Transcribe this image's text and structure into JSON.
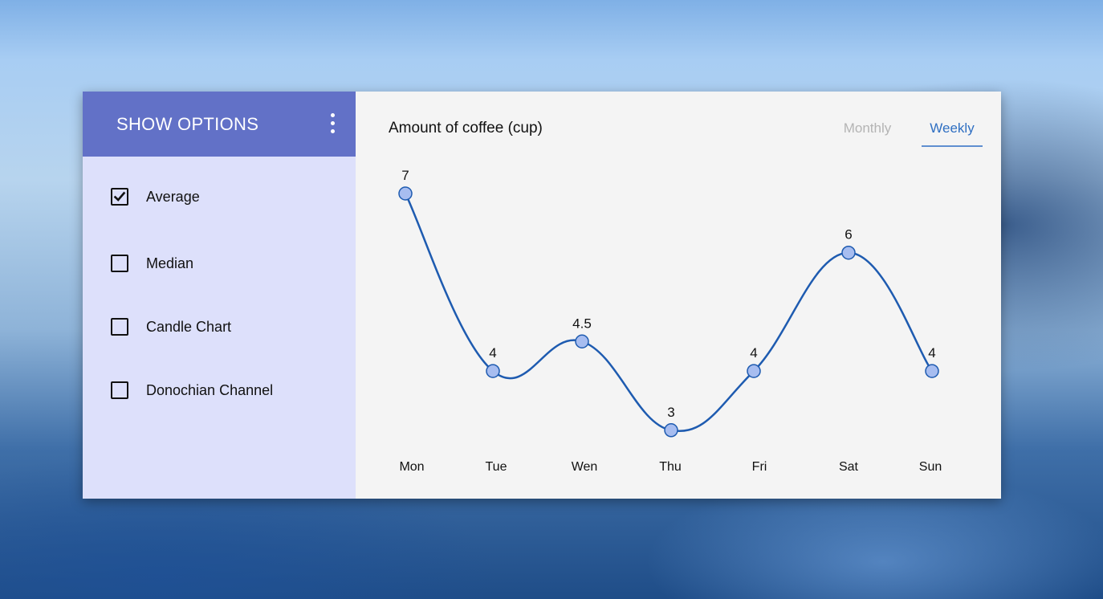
{
  "sidebar": {
    "title": "SHOW OPTIONS",
    "menu_icon": "kebab-menu-icon",
    "options": [
      {
        "label": "Average",
        "checked": true
      },
      {
        "label": "Median",
        "checked": false
      },
      {
        "label": "Candle Chart",
        "checked": false
      },
      {
        "label": "Donochian Channel",
        "checked": false
      }
    ]
  },
  "main": {
    "tabs": [
      {
        "label": "Monthly",
        "active": false
      },
      {
        "label": "Weekly",
        "active": true
      }
    ]
  },
  "colors": {
    "header": "#6271c7",
    "sidebar_bg": "#dde0fb",
    "line": "#1e5bb0",
    "point_fill": "#a7bdf0",
    "active_tab": "#2f6fc2"
  },
  "chart_data": {
    "type": "line",
    "title": "Amount of coffee (cup)",
    "categories": [
      "Mon",
      "Tue",
      "Wen",
      "Thu",
      "Fri",
      "Sat",
      "Sun"
    ],
    "values": [
      7,
      4,
      4.5,
      3,
      4,
      6,
      4
    ],
    "data_labels": [
      "7",
      "4",
      "4.5",
      "3",
      "4",
      "6",
      "4"
    ],
    "smooth": true,
    "grid": false
  }
}
